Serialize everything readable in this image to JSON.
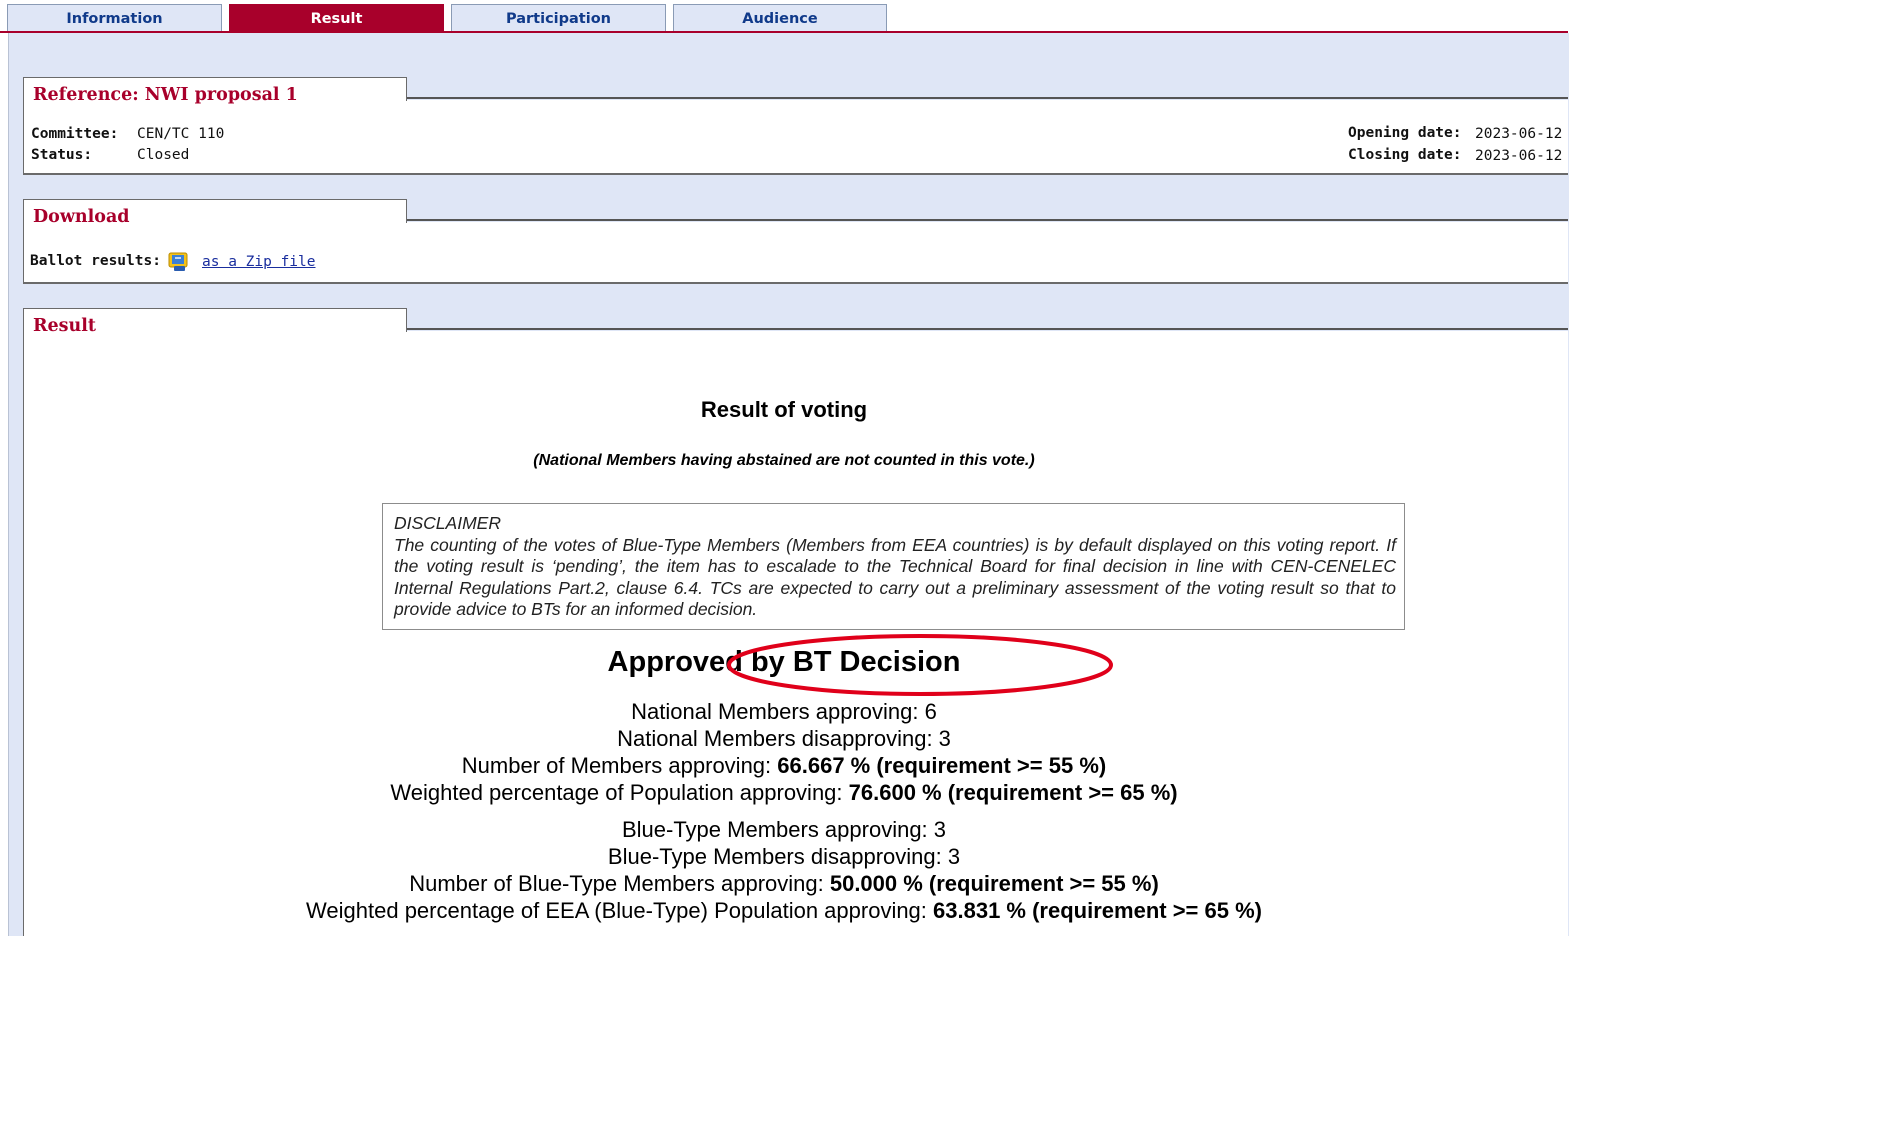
{
  "tabs": [
    {
      "label": "Information",
      "active": false
    },
    {
      "label": "Result",
      "active": true
    },
    {
      "label": "Participation",
      "active": false
    },
    {
      "label": "Audience",
      "active": false
    }
  ],
  "reference_panel": {
    "title": "Reference: NWI proposal 1",
    "committee_label": "Committee:",
    "committee_value": "CEN/TC 110",
    "status_label": "Status:",
    "status_value": "Closed",
    "opening_label": "Opening date:",
    "opening_value": "2023-06-12",
    "closing_label": "Closing date:",
    "closing_value": "2023-06-12"
  },
  "download_panel": {
    "title": "Download",
    "ballot_label": "Ballot results:",
    "icon": "zip-file-icon",
    "link_text": "as a Zip file"
  },
  "result_panel": {
    "title": "Result",
    "heading": "Result of voting",
    "note": "(National Members having abstained are not counted in this vote.)",
    "disclaimer_title": "DISCLAIMER",
    "disclaimer_text": "The counting of the votes of Blue-Type Members (Members from EEA countries) is by default displayed on this voting report. If the voting result is ‘pending’, the item has to escalade to the Technical Board for final decision in line with CEN-CENELEC Internal Regulations Part.2, clause 6.4. TCs are expected to carry out a preliminary assessment of the voting result so that to provide advice to BTs for an informed decision.",
    "decision": "Approved by BT Decision",
    "national": {
      "approving": "National Members approving: 6",
      "disapproving": "National Members disapproving: 3",
      "members_pct_label": "Number of Members approving: ",
      "members_pct_value": "66.667 % (requirement >= 55 %)",
      "population_pct_label": "Weighted percentage of Population approving: ",
      "population_pct_value": "76.600 % (requirement >= 65 %)"
    },
    "blue": {
      "approving": "Blue-Type Members approving: 3",
      "disapproving": "Blue-Type Members disapproving: 3",
      "members_pct_label": "Number of Blue-Type Members approving: ",
      "members_pct_value": "50.000 % (requirement >= 55 %)",
      "population_pct_label": "Weighted percentage of EEA (Blue-Type) Population approving: ",
      "population_pct_value": "63.831 % (requirement >= 65 %)"
    }
  },
  "colors": {
    "accent": "#a8002b",
    "tab_bg": "#dfe6f6",
    "highlight_ellipse": "#e0001a"
  }
}
